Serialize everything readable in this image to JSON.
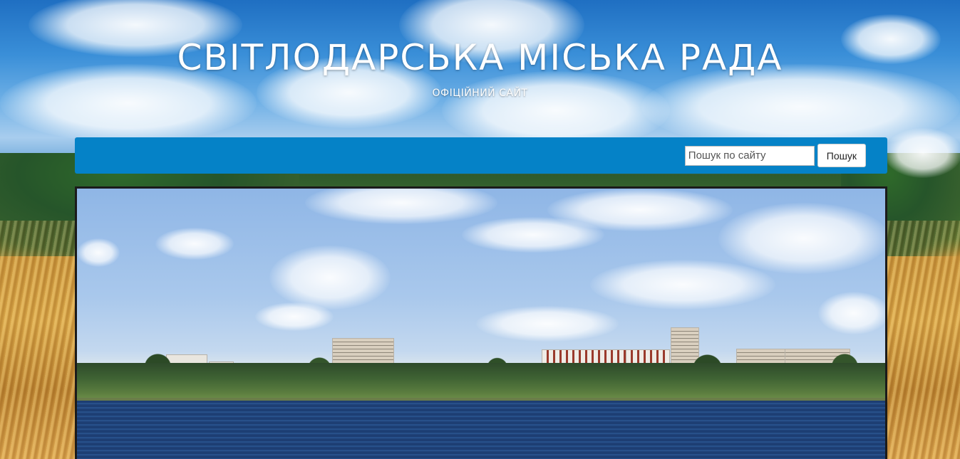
{
  "header": {
    "title": "СВІТЛОДАРСЬКА МІСЬКА РАДА",
    "subtitle": "ОФІЦІЙНИЙ САЙТ"
  },
  "navbar": {
    "background_color": "#0582c7",
    "search": {
      "placeholder": "Пошук по сайту",
      "value": "",
      "button_label": "Пошук"
    }
  },
  "banner": {
    "image_icon": "city-panorama-image"
  },
  "background": {
    "image_icon": "sky-and-wheat-field-background"
  }
}
